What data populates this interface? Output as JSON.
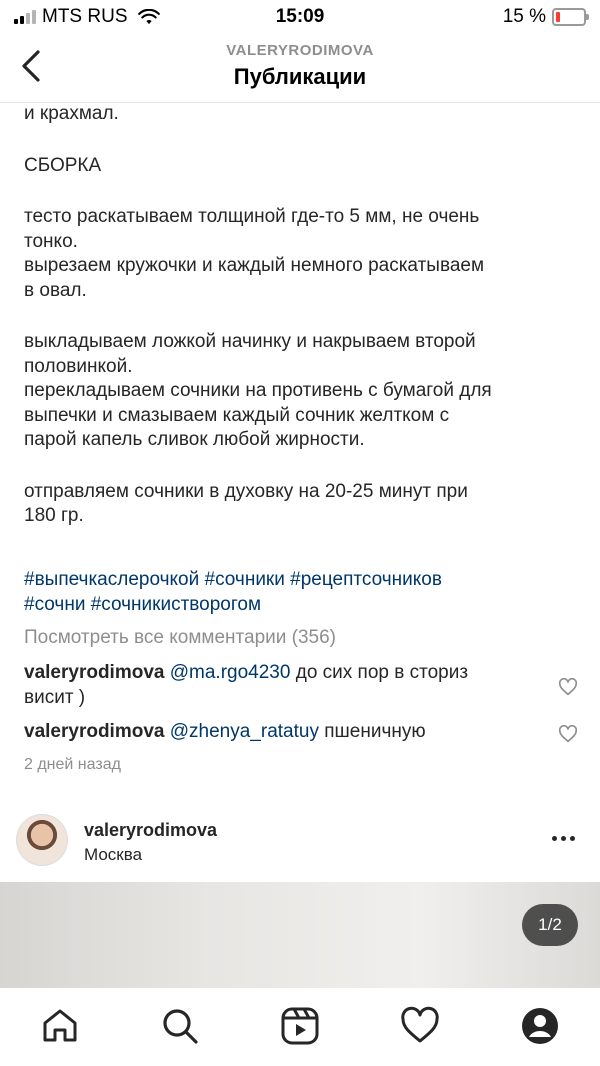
{
  "status_bar": {
    "carrier": "MTS RUS",
    "time": "15:09",
    "battery_percent": "15 %",
    "battery_level": 0.15,
    "signal_bars_filled": 2,
    "signal_bars_total": 4
  },
  "header": {
    "username": "VALERYRODIMOVA",
    "title": "Публикации"
  },
  "caption": {
    "lines": [
      "и крахмал.",
      "",
      "СБОРКА",
      "",
      "тесто раскатываем толщиной где-то 5 мм, не очень",
      "тонко.",
      "вырезаем кружочки и каждый немного раскатываем",
      "в овал.",
      "",
      "выкладываем ложкой начинку и накрываем второй",
      "половинкой.",
      "перекладываем сочники на противень с бумагой для",
      "выпечки и смазываем каждый сочник желтком с",
      "парой капель сливок любой жирности.",
      "",
      "отправляем сочники в духовку на 20-25 минут при",
      "180 гр."
    ],
    "hashtags": [
      "#выпечкаслерочкой",
      "#сочники",
      "#рецептсочников",
      "#сочни",
      "#сочникистворогом"
    ]
  },
  "comments": {
    "view_all": "Посмотреть все комментарии (356)",
    "items": [
      {
        "user": "valeryrodimova",
        "mention": "@ma.rgo4230",
        "text": " до сих пор в сториз",
        "text2": "висит )"
      },
      {
        "user": "valeryrodimova",
        "mention": "@zhenya_ratatuy",
        "text": " пшеничную"
      }
    ],
    "timestamp": "2 дней назад"
  },
  "next_post": {
    "username": "valeryrodimova",
    "location": "Москва",
    "page_indicator": "1/2"
  },
  "tab_bar": {
    "items": [
      "home-icon",
      "search-icon",
      "reels-icon",
      "heart-icon",
      "profile-icon"
    ]
  },
  "colors": {
    "hashtag": "#00376b",
    "secondary_text": "#8e8e8e",
    "battery_low": "#ff3b30"
  }
}
